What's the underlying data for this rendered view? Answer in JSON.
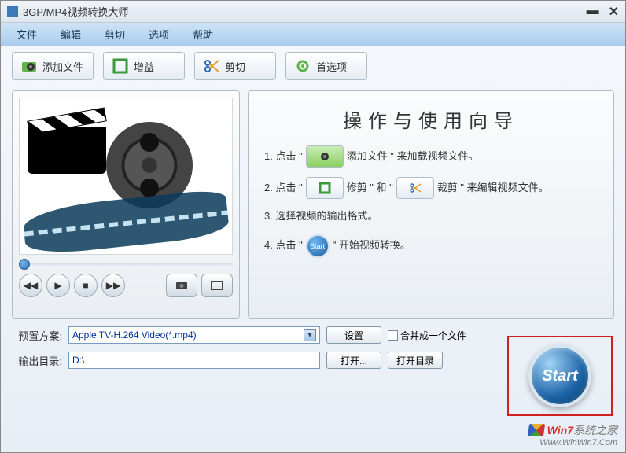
{
  "app": {
    "title": "3GP/MP4视频转换大师"
  },
  "menu": {
    "file": "文件",
    "edit": "编辑",
    "cut": "剪切",
    "options": "选项",
    "help": "帮助"
  },
  "toolbar": {
    "add_file": "添加文件",
    "gain": "增益",
    "cut": "剪切",
    "prefs": "首选项"
  },
  "guide": {
    "title": "操作与使用向导",
    "step1_a": "1. 点击 \"",
    "step1_b": "添加文件 \" 来加载视频文件。",
    "step2_a": "2. 点击 \"",
    "step2_b": "修剪  \"  和  \"",
    "step2_c": "裁剪 \" 来编辑视频文件。",
    "step3": "3. 选择视频的输出格式。",
    "step4_a": "4. 点击 \"",
    "step4_b": "\"  开始视频转换。",
    "start_badge": "Start"
  },
  "profile": {
    "label": "预置方案:",
    "value": "Apple TV-H.264 Video(*.mp4)",
    "settings_btn": "设置",
    "merge_label": "合并成一个文件"
  },
  "output": {
    "label": "输出目录:",
    "value": "D:\\",
    "open_btn": "打开...",
    "open_dir_btn": "打开目录"
  },
  "start_btn": "Start",
  "watermark": {
    "brand_hl": "Win7",
    "brand_rest": "系统之家",
    "url": "Www.WinWin7.Com"
  }
}
